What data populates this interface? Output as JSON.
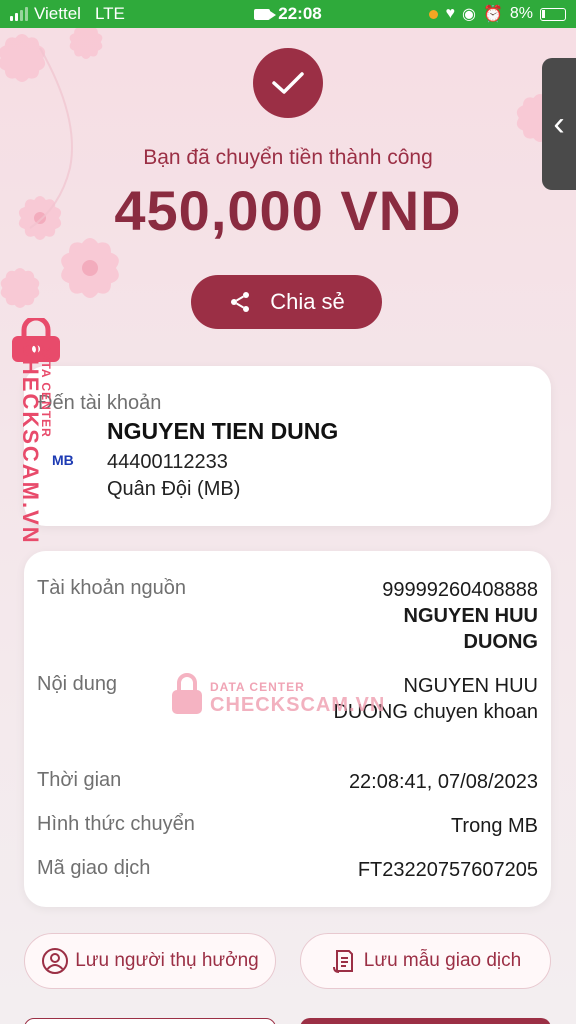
{
  "status_bar": {
    "carrier": "Viettel",
    "network": "LTE",
    "time": "22:08",
    "battery": "8%"
  },
  "header": {
    "message": "Bạn đã chuyển tiền thành công",
    "amount": "450,000 VND",
    "share_label": "Chia sẻ"
  },
  "destination": {
    "label": "Đến tài khoản",
    "bank_logo": "MB",
    "name": "NGUYEN TIEN DUNG",
    "account": "44400112233",
    "bank": "Quân Đội (MB)"
  },
  "details": {
    "source_label": "Tài khoản nguồn",
    "source_account": "99999260408888",
    "source_name_1": "NGUYEN HUU",
    "source_name_2": "DUONG",
    "content_label": "Nội dung",
    "content_1": "NGUYEN HUU",
    "content_2": "DUONG chuyen khoan",
    "time_label": "Thời gian",
    "time_value": "22:08:41, 07/08/2023",
    "method_label": "Hình thức chuyển",
    "method_value": "Trong MB",
    "txid_label": "Mã giao dịch",
    "txid_value": "FT23220757607205"
  },
  "actions": {
    "save_beneficiary": "Lưu người thụ hưởng",
    "save_template": "Lưu mẫu giao dịch"
  },
  "watermark": {
    "vertical_big": "CHECKSCAM.VN",
    "vertical_small": "DATA CENTER",
    "center_top": "DATA CENTER",
    "center_bottom": "CHECKSCAM.VN"
  },
  "colors": {
    "status_green": "#2faa3b",
    "brand": "#9b2f45",
    "watermark": "#e84b6b"
  },
  "icons": [
    "check-icon",
    "share-icon",
    "chevron-left-icon",
    "person-icon",
    "document-icon",
    "lock-icon"
  ]
}
